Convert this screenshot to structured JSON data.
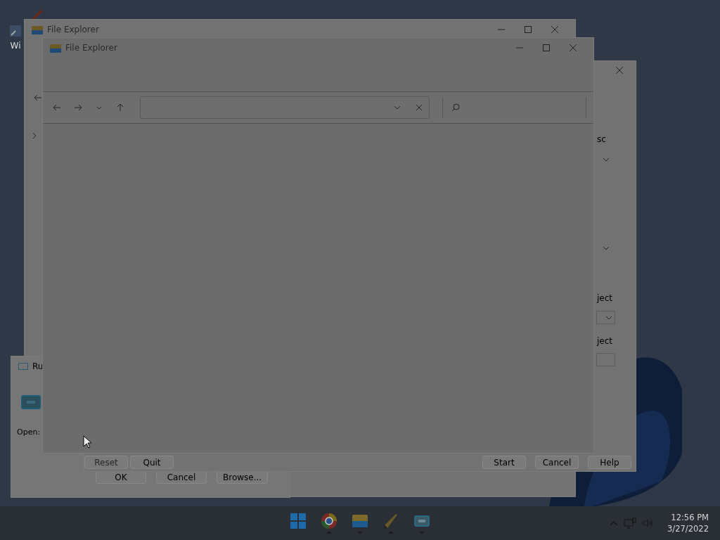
{
  "desktop": {
    "icons": [
      {
        "label": "Wi"
      }
    ]
  },
  "explorer_back": {
    "title": "File Explorer"
  },
  "settings_dialog": {
    "labels": [
      "sc",
      "ject",
      "ject"
    ],
    "buttons": [
      {
        "label": "Reset",
        "disabled": true
      },
      {
        "label": "Quit",
        "disabled": false
      },
      {
        "label": "Start",
        "disabled": false
      },
      {
        "label": "Cancel",
        "disabled": false
      },
      {
        "label": "Help",
        "disabled": false
      }
    ]
  },
  "run_dialog": {
    "title": "Ru",
    "open_label": "Open:",
    "buttons": [
      {
        "label": "OK"
      },
      {
        "label": "Cancel"
      },
      {
        "label": "Browse..."
      }
    ]
  },
  "explorer_front": {
    "title": "File Explorer"
  },
  "taskbar": {
    "apps": [
      {
        "kind": "start",
        "running": false
      },
      {
        "kind": "browser",
        "running": true
      },
      {
        "kind": "folder",
        "running": true
      },
      {
        "kind": "pen",
        "running": true
      },
      {
        "kind": "run",
        "running": true
      }
    ],
    "clock": {
      "time": "12:56 PM",
      "date": "3/27/2022"
    }
  }
}
